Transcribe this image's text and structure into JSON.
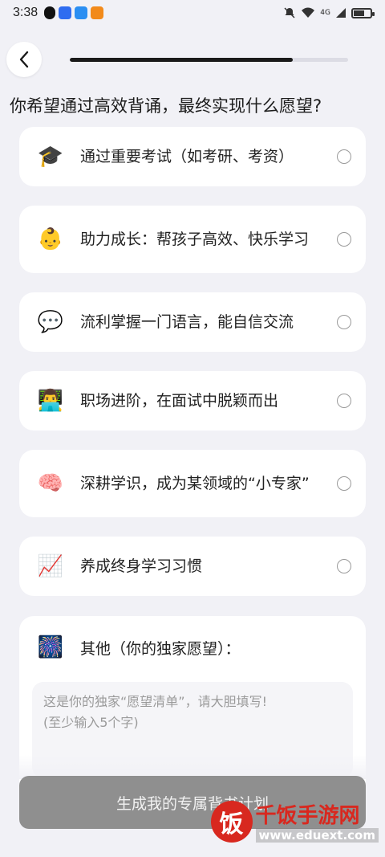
{
  "status_bar": {
    "time": "3:38",
    "signal_text": "4G",
    "app_icons": [
      {
        "name": "qq-icon",
        "color": "#111111"
      },
      {
        "name": "shield-app-icon",
        "color": "#2f6cf0"
      },
      {
        "name": "cloud-app-icon",
        "color": "#2a8ef2"
      },
      {
        "name": "video-app-icon",
        "color": "#f28a1a"
      }
    ]
  },
  "progress": {
    "fraction": 0.8
  },
  "question": "你希望通过高效背诵，最终实现什么愿望?",
  "options": [
    {
      "emoji": "🎓",
      "icon": "graduation-cap-icon",
      "label": "通过重要考试（如考研、考资）"
    },
    {
      "emoji": "👶",
      "icon": "baby-icon",
      "label": "助力成长：帮孩子高效、快乐学习"
    },
    {
      "emoji": "💬",
      "icon": "speech-bubble-icon",
      "label": "流利掌握一门语言，能自信交流"
    },
    {
      "emoji": "👨‍💻",
      "icon": "office-worker-icon",
      "label": "职场进阶，在面试中脱颖而出"
    },
    {
      "emoji": "🧠",
      "icon": "brain-icon",
      "label": "深耕学识，成为某领域的“小专家”"
    },
    {
      "emoji": "📈",
      "icon": "chart-increasing-icon",
      "label": "养成终身学习习惯"
    }
  ],
  "other": {
    "emoji": "🎆",
    "icon": "fireworks-icon",
    "label": "其他（你的独家愿望）：",
    "placeholder": "这是你的独家“愿望清单”，请大胆填写!\n(至少输入5个字)"
  },
  "submit_label": "生成我的专属背书计划",
  "watermark": {
    "logo_char": "饭",
    "name": "千饭手游网",
    "url": "www.eduext.com"
  }
}
